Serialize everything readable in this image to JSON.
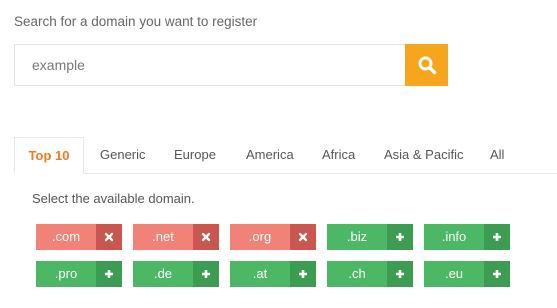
{
  "search": {
    "label": "Search for a domain you want to register",
    "placeholder": "example",
    "value": ""
  },
  "tabs": [
    {
      "label": "Top 10",
      "active": true
    },
    {
      "label": "Generic",
      "active": false
    },
    {
      "label": "Europe",
      "active": false
    },
    {
      "label": "America",
      "active": false
    },
    {
      "label": "Africa",
      "active": false
    },
    {
      "label": "Asia & Pacific",
      "active": false
    },
    {
      "label": "All",
      "active": false
    }
  ],
  "panel": {
    "label": "Select the available domain."
  },
  "domains": [
    {
      "tld": ".com",
      "available": false,
      "icon": "remove-icon"
    },
    {
      "tld": ".net",
      "available": false,
      "icon": "remove-icon"
    },
    {
      "tld": ".org",
      "available": false,
      "icon": "remove-icon"
    },
    {
      "tld": ".biz",
      "available": true,
      "icon": "add-icon"
    },
    {
      "tld": ".info",
      "available": true,
      "icon": "add-icon"
    },
    {
      "tld": ".pro",
      "available": true,
      "icon": "add-icon"
    },
    {
      "tld": ".de",
      "available": true,
      "icon": "add-icon"
    },
    {
      "tld": ".at",
      "available": true,
      "icon": "add-icon"
    },
    {
      "tld": ".ch",
      "available": true,
      "icon": "add-icon"
    },
    {
      "tld": ".eu",
      "available": true,
      "icon": "add-icon"
    }
  ],
  "colors": {
    "accent": "#f7a51c",
    "tab_active": "#f37b21",
    "taken": "#f08278",
    "taken_dark": "#c9574f",
    "available": "#4cb764",
    "available_dark": "#3c9c52"
  }
}
